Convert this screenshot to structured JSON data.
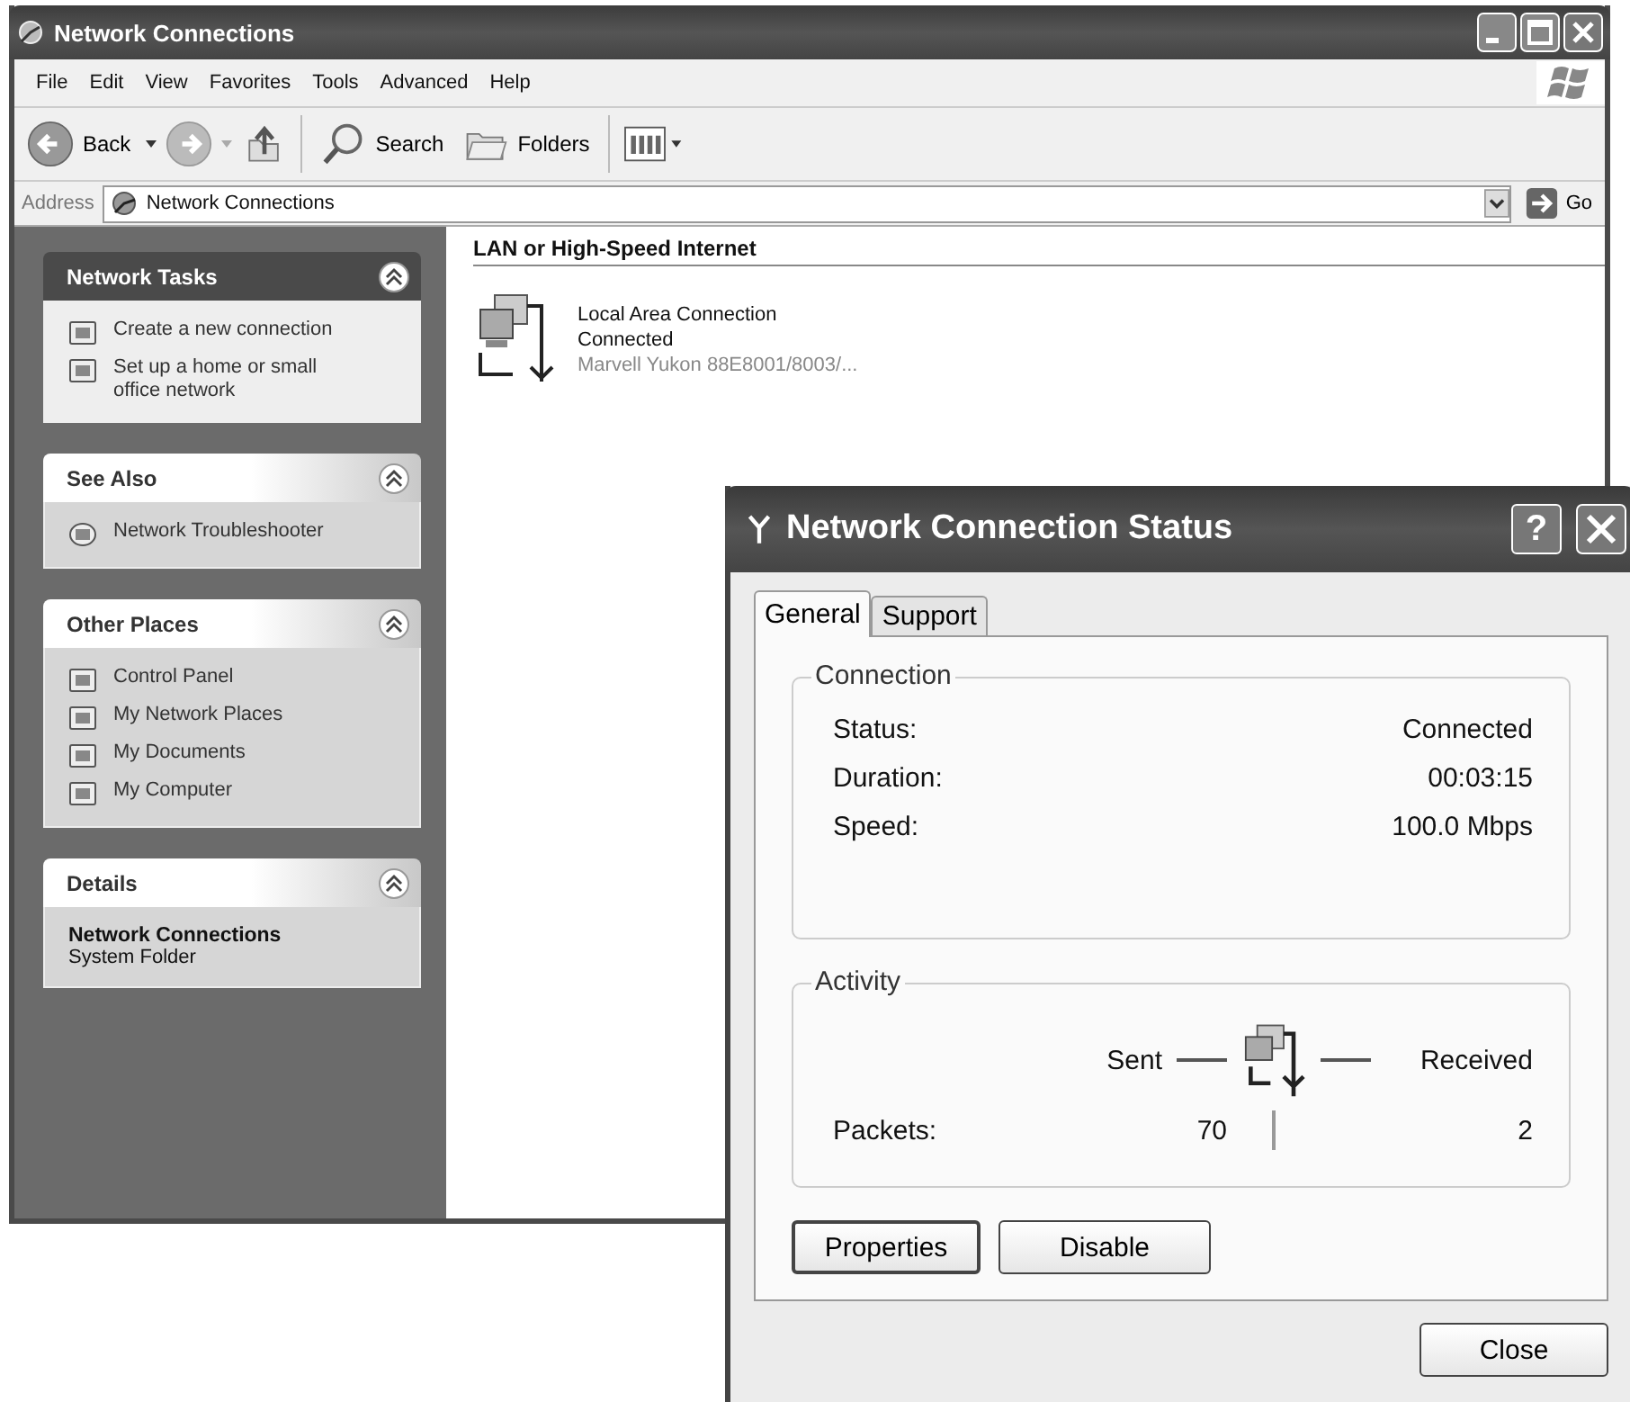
{
  "window": {
    "title": "Network Connections",
    "menu": [
      "File",
      "Edit",
      "View",
      "Favorites",
      "Tools",
      "Advanced",
      "Help"
    ],
    "toolbar": {
      "back": "Back",
      "search": "Search",
      "folders": "Folders"
    },
    "address": {
      "label": "Address",
      "value": "Network Connections",
      "go": "Go"
    },
    "task_panes": [
      {
        "kind": "special",
        "title": "Network Tasks",
        "expanded": true,
        "items": [
          {
            "label": "Create a new connection"
          },
          {
            "label": "Set up a home or small office network"
          }
        ]
      },
      {
        "kind": "normal",
        "title": "See Also",
        "expanded": true,
        "items": [
          {
            "label": "Network Troubleshooter"
          }
        ]
      },
      {
        "kind": "normal",
        "title": "Other Places",
        "expanded": true,
        "items": [
          {
            "label": "Control Panel"
          },
          {
            "label": "My Network Places"
          },
          {
            "label": "My Documents"
          },
          {
            "label": "My Computer"
          }
        ]
      },
      {
        "kind": "details",
        "title": "Details",
        "expanded": true,
        "name": "Network Connections",
        "description": "System Folder"
      }
    ],
    "content": {
      "group": "LAN or High-Speed Internet",
      "connections": [
        {
          "name": "Local Area Connection",
          "status": "Connected",
          "device": "Marvell Yukon 88E8001/8003/..."
        }
      ]
    }
  },
  "dialog": {
    "title": "Network Connection Status",
    "help": "?",
    "tabs": [
      {
        "label": "General",
        "selected": true
      },
      {
        "label": "Support",
        "selected": false
      }
    ],
    "connection": {
      "legend": "Connection",
      "rows": [
        {
          "label": "Status:",
          "value": "Connected"
        },
        {
          "label": "Duration:",
          "value": "00:03:15"
        },
        {
          "label": "Speed:",
          "value": "100.0 Mbps"
        }
      ]
    },
    "activity": {
      "legend": "Activity",
      "sent": "Sent",
      "received": "Received",
      "packets_label": "Packets:",
      "packets_sent": "70",
      "packets_received": "2"
    },
    "buttons": [
      {
        "label": "Properties",
        "default": true
      },
      {
        "label": "Disable",
        "default": false
      }
    ],
    "close": "Close"
  }
}
